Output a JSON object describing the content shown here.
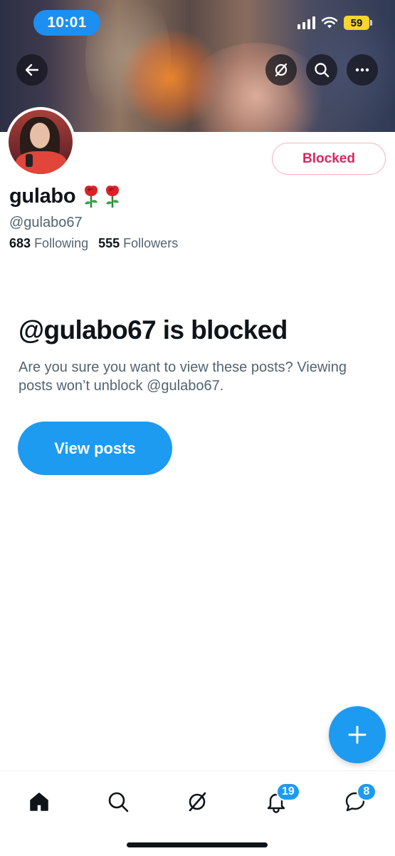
{
  "status_bar": {
    "time": "10:01",
    "battery": "59",
    "icons": [
      "cellular-signal-icon",
      "wifi-icon",
      "battery-icon"
    ]
  },
  "banner": {
    "icons": [
      "back-arrow-icon",
      "grok-icon",
      "search-icon",
      "more-icon"
    ]
  },
  "profile": {
    "display_name": "gulabo",
    "name_emoji": [
      "rose",
      "rose"
    ],
    "handle": "@gulabo67",
    "following_count": "683",
    "following_label": "Following",
    "followers_count": "555",
    "followers_label": "Followers",
    "blocked_button_label": "Blocked"
  },
  "blocked_notice": {
    "title": "@gulabo67 is blocked",
    "description": "Are you sure you want to view these posts? Viewing posts won’t unblock @gulabo67.",
    "view_button_label": "View posts"
  },
  "fab": {
    "icon": "plus-icon"
  },
  "tab_bar": {
    "items": [
      {
        "icon": "home-icon",
        "active": true
      },
      {
        "icon": "search-icon"
      },
      {
        "icon": "grok-icon"
      },
      {
        "icon": "bell-icon",
        "badge": "19"
      },
      {
        "icon": "messages-icon",
        "badge": "8"
      }
    ]
  },
  "colors": {
    "accent": "#1d9bf0",
    "blocked_red": "#e0245e",
    "text_primary": "#0f1419",
    "text_secondary": "#536471",
    "battery_yellow": "#f6d52c"
  }
}
